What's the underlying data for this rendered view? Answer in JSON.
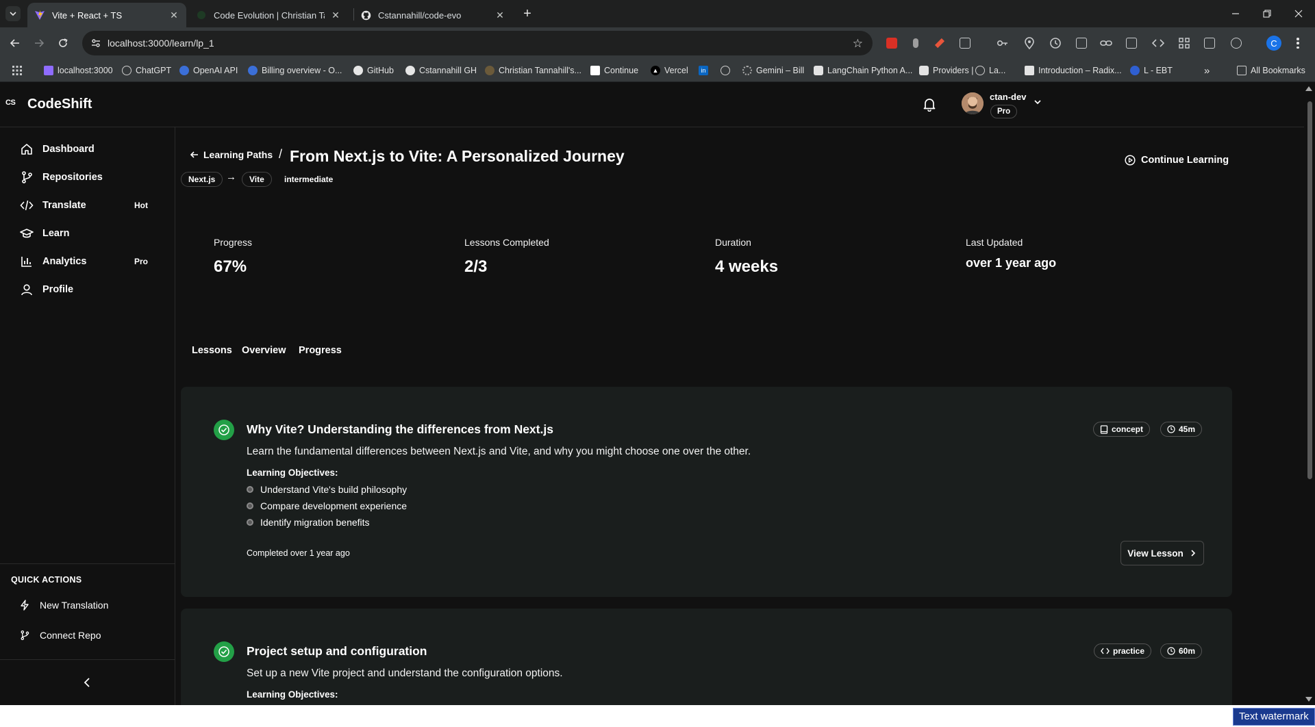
{
  "browser": {
    "tabs": [
      {
        "title": "Vite + React + TS",
        "active": true
      },
      {
        "title": "Code Evolution | Christian Tann",
        "active": false
      },
      {
        "title": "Cstannahill/code-evo",
        "active": false
      }
    ],
    "url": "localhost:3000/learn/lp_1",
    "profile_initial": "C",
    "bookmarks": [
      "localhost:3000",
      "ChatGPT",
      "OpenAI API",
      "Billing overview - O...",
      "GitHub",
      "Cstannahill GH",
      "Christian Tannahill's...",
      "Continue",
      "Vercel",
      "",
      "",
      "Gemini – Bill",
      "LangChain Python A...",
      "Providers |",
      "La...",
      "Introduction – Radix...",
      "L - EBT"
    ],
    "all_bookmarks": "All Bookmarks"
  },
  "app": {
    "brand_mark": "CS",
    "brand": "CodeShift",
    "user": {
      "name": "ctan-dev",
      "plan": "Pro"
    },
    "nav": [
      {
        "label": "Dashboard",
        "icon": "home-icon",
        "badge": ""
      },
      {
        "label": "Repositories",
        "icon": "git-branch-icon",
        "badge": ""
      },
      {
        "label": "Translate",
        "icon": "code-icon",
        "badge": "Hot"
      },
      {
        "label": "Learn",
        "icon": "graduation-cap-icon",
        "badge": ""
      },
      {
        "label": "Analytics",
        "icon": "bar-chart-icon",
        "badge": "Pro"
      },
      {
        "label": "Profile",
        "icon": "user-icon",
        "badge": ""
      }
    ],
    "quick_actions": {
      "heading": "QUICK ACTIONS",
      "items": [
        {
          "label": "New Translation",
          "icon": "zap-icon"
        },
        {
          "label": "Connect Repo",
          "icon": "git-branch-icon"
        }
      ]
    }
  },
  "page": {
    "back_label": "Learning Paths",
    "slash": "/",
    "title": "From Next.js to Vite: A Personalized Journey",
    "from_tech": "Next.js",
    "arrow": "→",
    "to_tech": "Vite",
    "level": "intermediate",
    "continue_label": "Continue Learning",
    "stats": [
      {
        "label": "Progress",
        "value": "67%"
      },
      {
        "label": "Lessons Completed",
        "value": "2/3"
      },
      {
        "label": "Duration",
        "value": "4 weeks"
      },
      {
        "label": "Last Updated",
        "value": "over 1 year ago"
      }
    ],
    "tabs": [
      "Lessons",
      "Overview",
      "Progress"
    ],
    "lessons": [
      {
        "title": "Why Vite? Understanding the differences from Next.js",
        "description": "Learn the fundamental differences between Next.js and Vite, and why you might choose one over the other.",
        "objectives_heading": "Learning Objectives:",
        "objectives": [
          "Understand Vite's build philosophy",
          "Compare development experience",
          "Identify migration benefits"
        ],
        "type": "concept",
        "duration": "45m",
        "completed": "Completed over 1 year ago",
        "view_label": "View Lesson"
      },
      {
        "title": "Project setup and configuration",
        "description": "Set up a new Vite project and understand the configuration options.",
        "objectives_heading": "Learning Objectives:",
        "type": "practice",
        "duration": "60m"
      }
    ]
  },
  "watermark": "Text watermark",
  "colors": {
    "accent_green": "#23a047",
    "card_bg": "#1a1e1d",
    "app_bg": "#111111"
  }
}
